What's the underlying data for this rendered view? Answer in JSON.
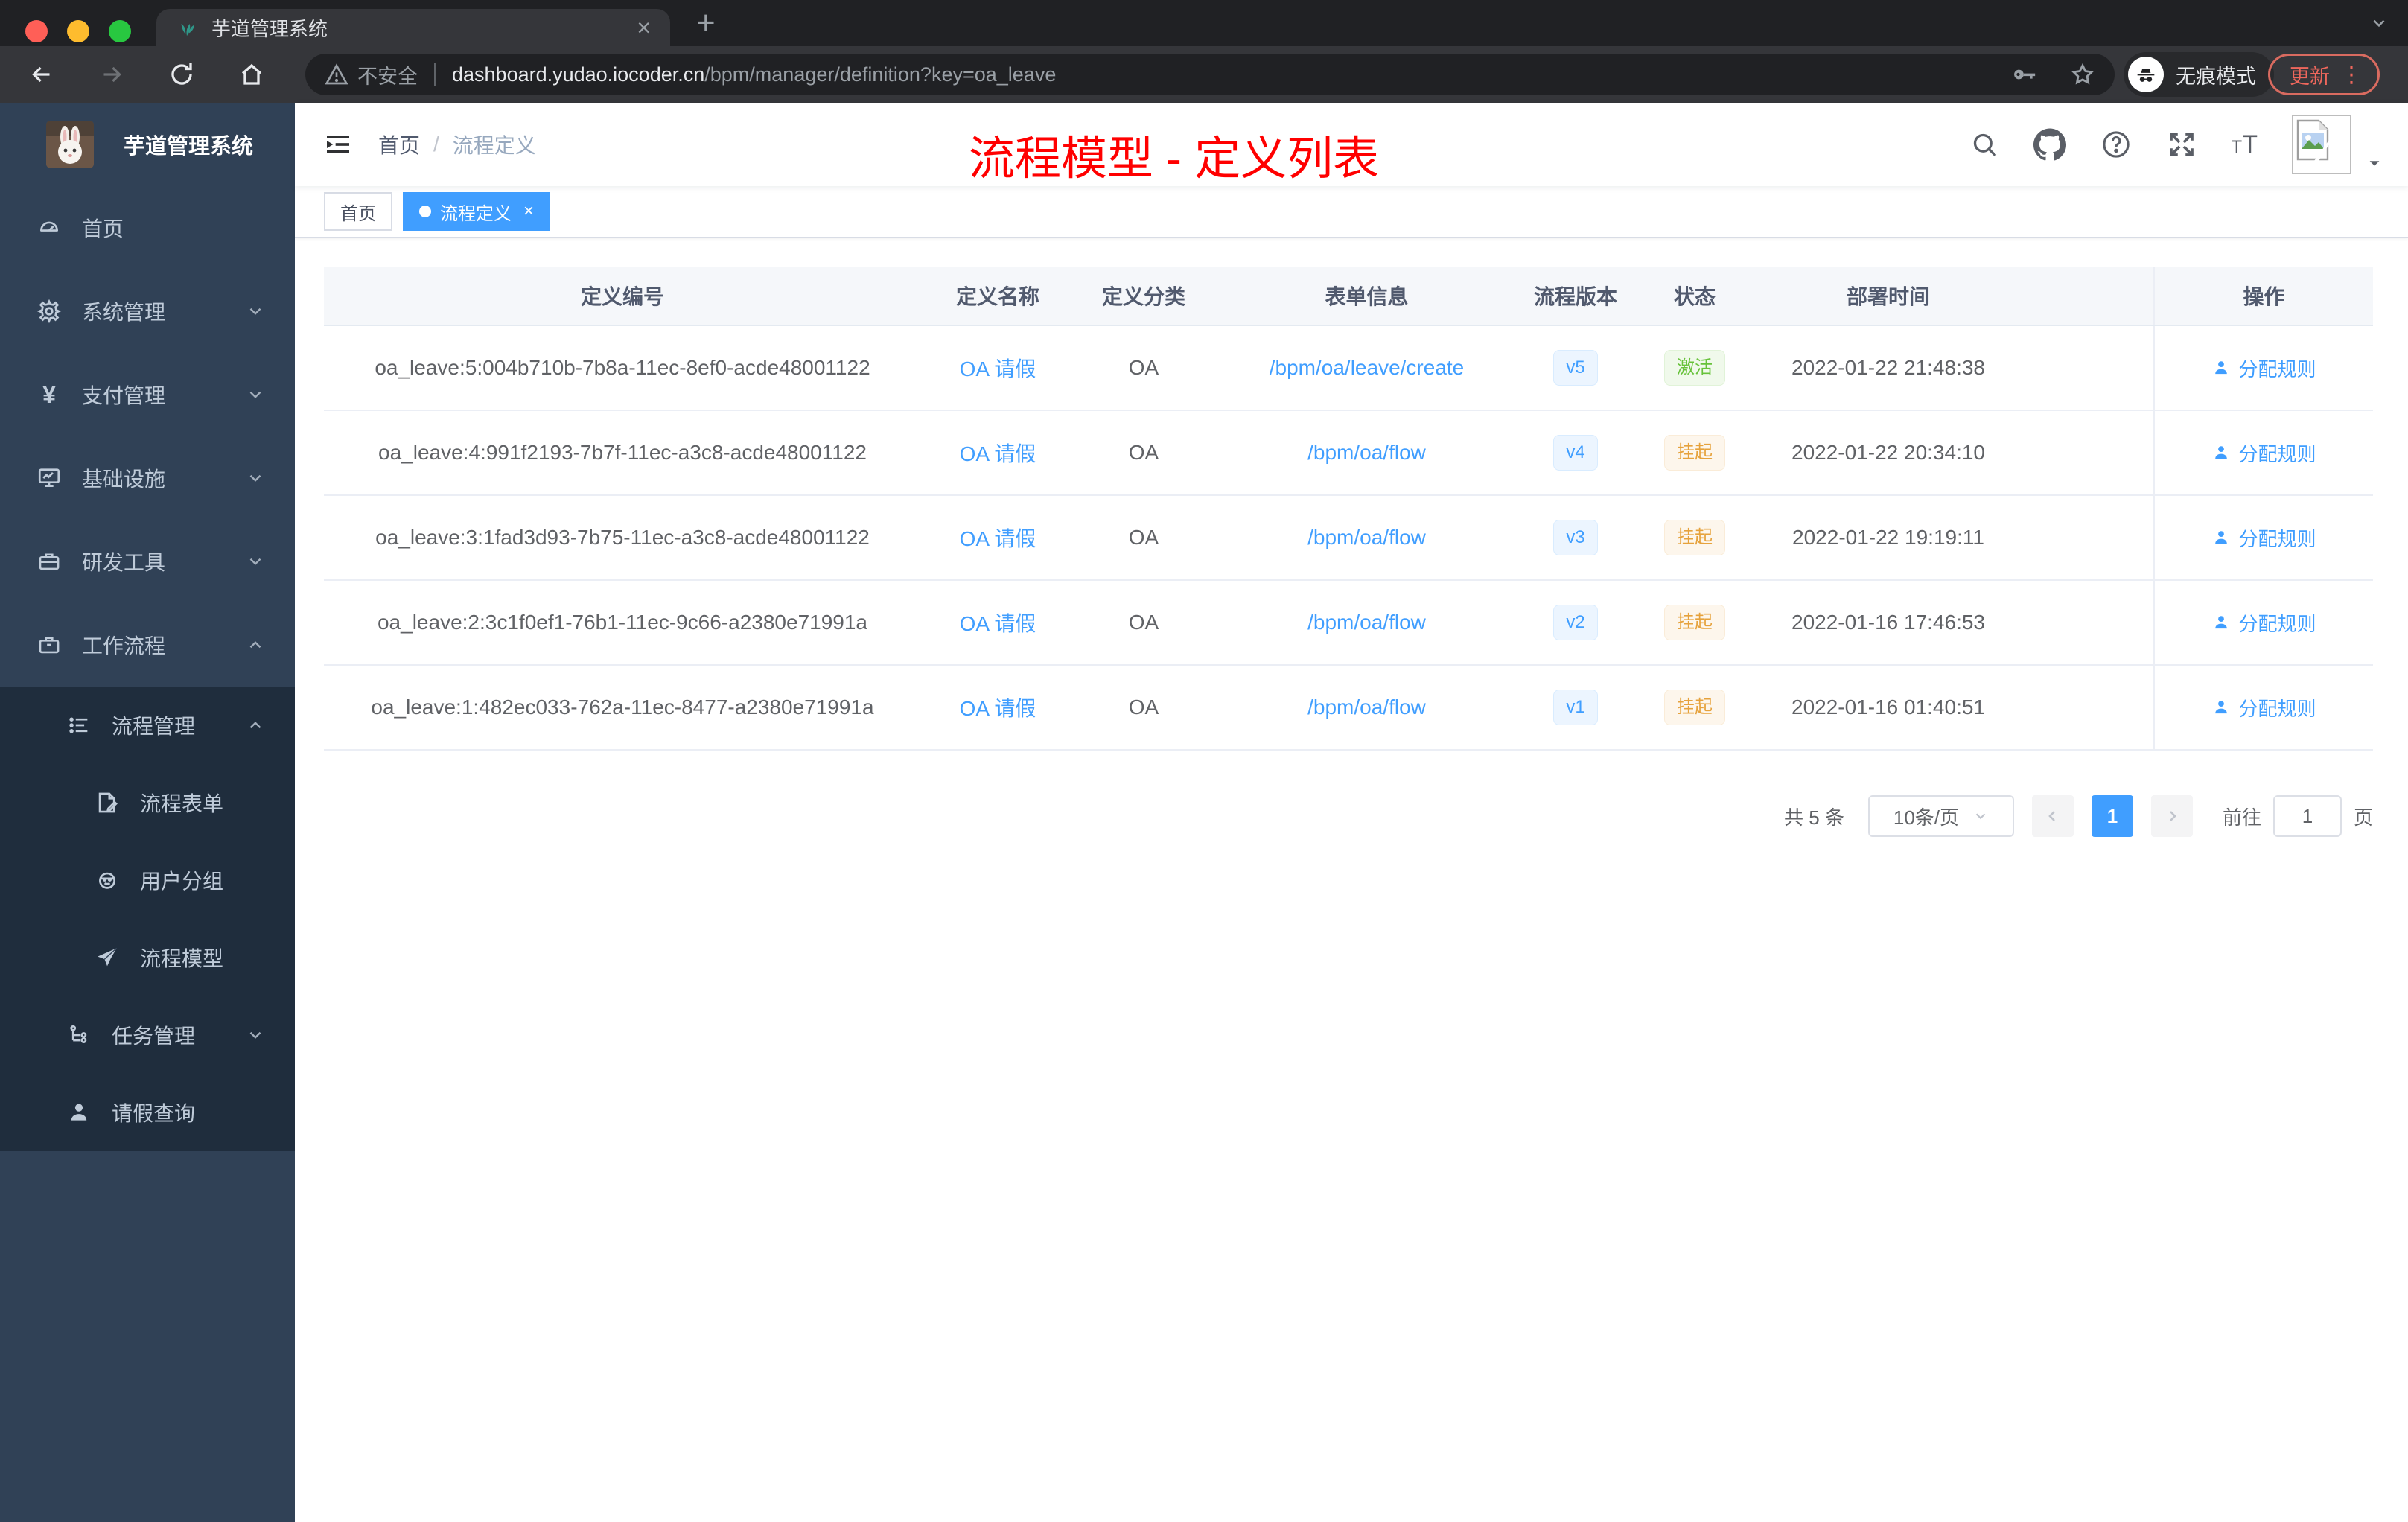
{
  "browser": {
    "tab_title": "芋道管理系统",
    "security_label": "不安全",
    "url_domain": "dashboard.yudao.iocoder.cn",
    "url_path": "/bpm/manager/definition?key=oa_leave",
    "incognito_label": "无痕模式",
    "update_label": "更新"
  },
  "sidebar": {
    "app_title": "芋道管理系统",
    "items": [
      {
        "icon": "dashboard",
        "label": "首页",
        "level": 1,
        "chevron": "",
        "dark": false
      },
      {
        "icon": "gear",
        "label": "系统管理",
        "level": 1,
        "chevron": "down",
        "dark": false
      },
      {
        "icon": "yen",
        "label": "支付管理",
        "level": 1,
        "chevron": "down",
        "dark": false
      },
      {
        "icon": "monitor",
        "label": "基础设施",
        "level": 1,
        "chevron": "down",
        "dark": false
      },
      {
        "icon": "toolbox",
        "label": "研发工具",
        "level": 1,
        "chevron": "down",
        "dark": false
      },
      {
        "icon": "briefcase",
        "label": "工作流程",
        "level": 1,
        "chevron": "up",
        "dark": false
      },
      {
        "icon": "flowlist",
        "label": "流程管理",
        "level": 2,
        "chevron": "up",
        "dark": true
      },
      {
        "icon": "form",
        "label": "流程表单",
        "level": 3,
        "chevron": "",
        "dark": true
      },
      {
        "icon": "group",
        "label": "用户分组",
        "level": 3,
        "chevron": "",
        "dark": true
      },
      {
        "icon": "model",
        "label": "流程模型",
        "level": 3,
        "chevron": "",
        "dark": true
      },
      {
        "icon": "task",
        "label": "任务管理",
        "level": 2,
        "chevron": "down",
        "dark": true
      },
      {
        "icon": "person",
        "label": "请假查询",
        "level": 2,
        "chevron": "",
        "dark": true
      }
    ]
  },
  "header": {
    "breadcrumb": [
      "首页",
      "流程定义"
    ],
    "annotation": "流程模型 - 定义列表"
  },
  "tags": [
    {
      "label": "首页",
      "active": false
    },
    {
      "label": "流程定义",
      "active": true
    }
  ],
  "table": {
    "columns": [
      "定义编号",
      "定义名称",
      "定义分类",
      "表单信息",
      "流程版本",
      "状态",
      "部署时间"
    ],
    "action_column": "操作",
    "action_label": "分配规则",
    "rows": [
      {
        "id": "oa_leave:5:004b710b-7b8a-11ec-8ef0-acde48001122",
        "name": "OA 请假",
        "category": "OA",
        "form": "/bpm/oa/leave/create",
        "version": "v5",
        "status": "激活",
        "status_type": "success",
        "time": "2022-01-22 21:48:38"
      },
      {
        "id": "oa_leave:4:991f2193-7b7f-11ec-a3c8-acde48001122",
        "name": "OA 请假",
        "category": "OA",
        "form": "/bpm/oa/flow",
        "version": "v4",
        "status": "挂起",
        "status_type": "warning",
        "time": "2022-01-22 20:34:10"
      },
      {
        "id": "oa_leave:3:1fad3d93-7b75-11ec-a3c8-acde48001122",
        "name": "OA 请假",
        "category": "OA",
        "form": "/bpm/oa/flow",
        "version": "v3",
        "status": "挂起",
        "status_type": "warning",
        "time": "2022-01-22 19:19:11"
      },
      {
        "id": "oa_leave:2:3c1f0ef1-76b1-11ec-9c66-a2380e71991a",
        "name": "OA 请假",
        "category": "OA",
        "form": "/bpm/oa/flow",
        "version": "v2",
        "status": "挂起",
        "status_type": "warning",
        "time": "2022-01-16 17:46:53"
      },
      {
        "id": "oa_leave:1:482ec033-762a-11ec-8477-a2380e71991a",
        "name": "OA 请假",
        "category": "OA",
        "form": "/bpm/oa/flow",
        "version": "v1",
        "status": "挂起",
        "status_type": "warning",
        "time": "2022-01-16 01:40:51"
      }
    ]
  },
  "pagination": {
    "total_label": "共 5 条",
    "page_size_label": "10条/页",
    "current_page": "1",
    "goto_label": "前往",
    "goto_value": "1",
    "page_unit_label": "页"
  },
  "colors": {
    "accent": "#409eff",
    "success": "#67c23a",
    "warning": "#e6a23c",
    "annotation_red": "#ff0000",
    "sidebar_bg": "#304156",
    "submenu_bg": "#1f2d3d",
    "chrome_dark": "#202124",
    "chrome_toolbar": "#35363a"
  }
}
